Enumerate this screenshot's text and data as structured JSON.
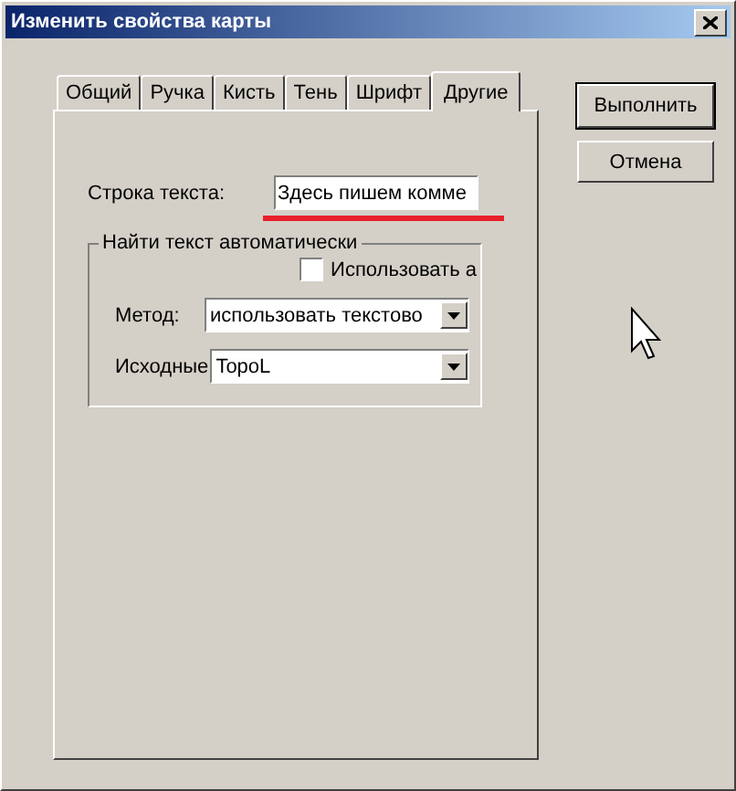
{
  "window": {
    "title": "Изменить свойства карты"
  },
  "tabs": [
    {
      "label": "Общий",
      "selected": false
    },
    {
      "label": "Ручка",
      "selected": false
    },
    {
      "label": "Кисть",
      "selected": false
    },
    {
      "label": "Тень",
      "selected": false
    },
    {
      "label": "Шрифт",
      "selected": false
    },
    {
      "label": "Другие",
      "selected": true
    }
  ],
  "text_line": {
    "label": "Строка текста:",
    "value": "Здесь пишем комме",
    "underlined": true
  },
  "auto_group": {
    "legend": "Найти текст автоматически",
    "checkbox": {
      "label": "Использовать а",
      "checked": false
    },
    "method": {
      "label": "Метод:",
      "value": "использовать текстово"
    },
    "source": {
      "label": "Исходные",
      "value": "TopoL"
    }
  },
  "buttons": [
    {
      "label": "Выполнить",
      "default": true
    },
    {
      "label": "Отмена",
      "default": false
    }
  ]
}
